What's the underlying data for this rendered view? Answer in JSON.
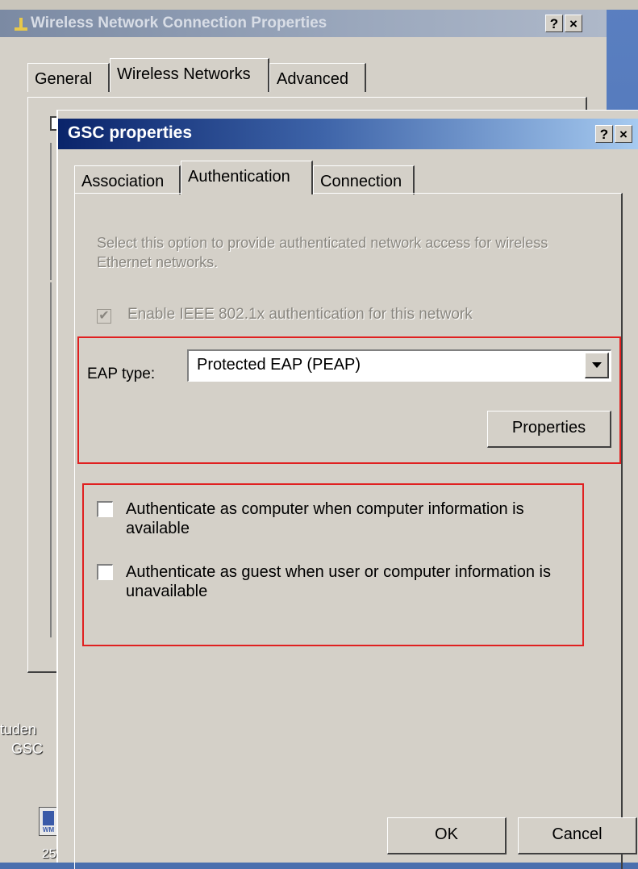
{
  "back_window": {
    "title": "Wireless Network Connection Properties",
    "help_label": "?",
    "close_label": "×",
    "tabs": [
      "General",
      "Wireless Networks",
      "Advanced"
    ]
  },
  "desktop": {
    "label_line1": "tuden",
    "label_line2": "GSC",
    "icon_label": "25",
    "icon_caption": "WM"
  },
  "dialog": {
    "title": "GSC properties",
    "help_label": "?",
    "close_label": "×",
    "tabs": [
      "Association",
      "Authentication",
      "Connection"
    ],
    "active_tab": "Authentication",
    "description": "Select this option to provide authenticated network access for wireless Ethernet networks.",
    "enable_8021x": {
      "label": "Enable IEEE 802.1x authentication for this network",
      "checked": true,
      "disabled": true,
      "mark": "✔"
    },
    "eap_type": {
      "label": "EAP type:",
      "value": "Protected EAP (PEAP)"
    },
    "properties_button": "Properties",
    "auth_as_computer": {
      "label": "Authenticate as computer when computer information is available",
      "checked": false
    },
    "auth_as_guest": {
      "label": "Authenticate as guest when user or computer information is unavailable",
      "checked": false
    },
    "ok_button": "OK",
    "cancel_button": "Cancel",
    "highlight_color": "#e02020"
  }
}
